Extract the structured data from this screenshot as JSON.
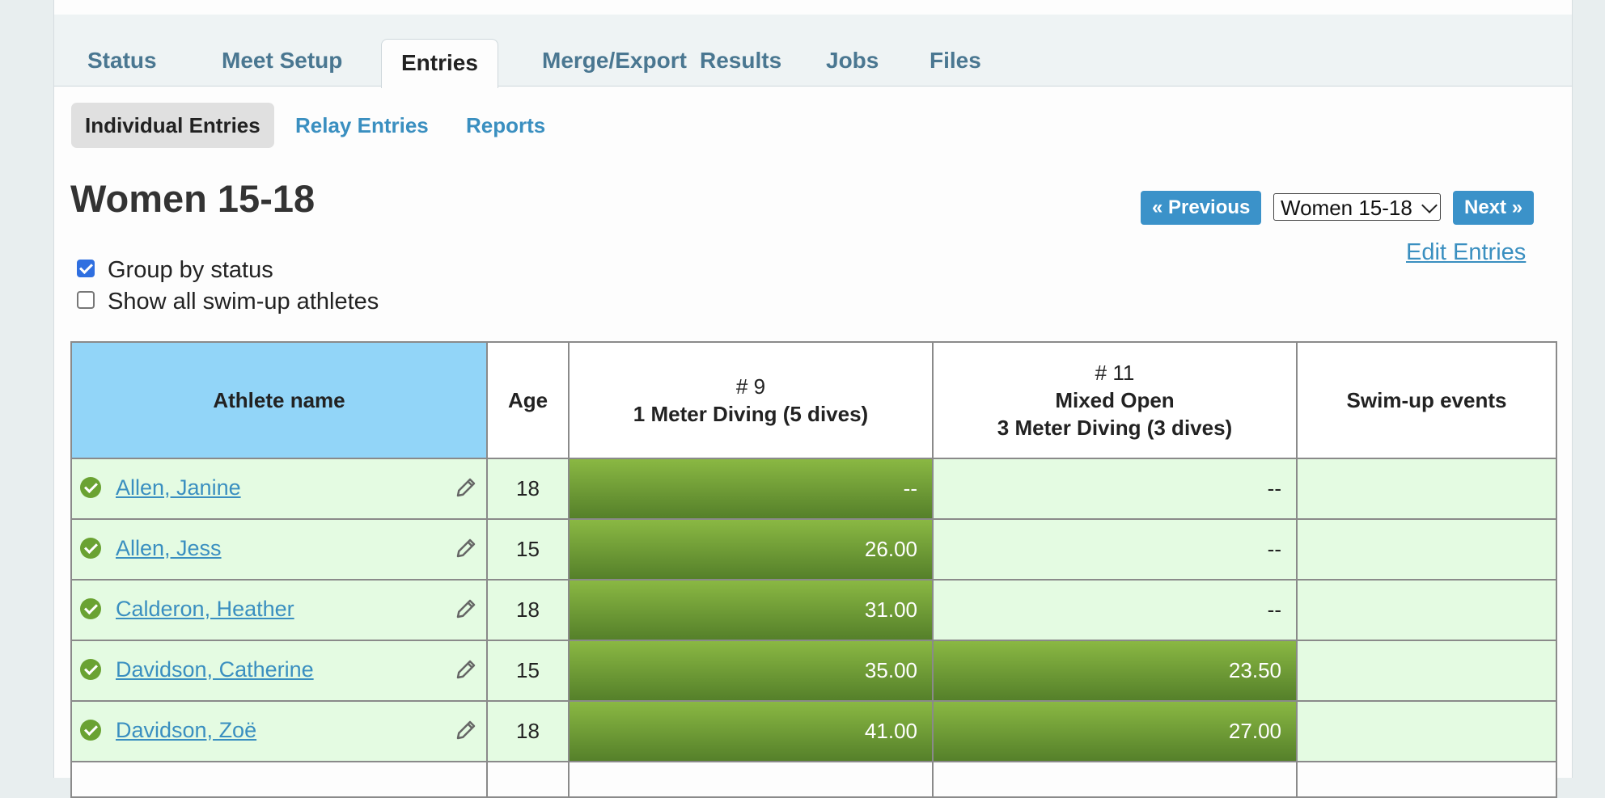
{
  "tabs": [
    {
      "label": "Status",
      "active": false
    },
    {
      "label": "Meet Setup",
      "active": false
    },
    {
      "label": "Entries",
      "active": true
    },
    {
      "label": "Merge/Export",
      "active": false
    },
    {
      "label": "Results",
      "active": false
    },
    {
      "label": "Jobs",
      "active": false
    },
    {
      "label": "Files",
      "active": false
    }
  ],
  "subtabs": [
    {
      "label": "Individual Entries",
      "active": true
    },
    {
      "label": "Relay Entries",
      "active": false
    },
    {
      "label": "Reports",
      "active": false
    }
  ],
  "page_title": "Women 15-18",
  "nav": {
    "previous_label": "« Previous",
    "next_label": "Next »",
    "group_select_value": "Women 15-18",
    "edit_entries_label": "Edit Entries"
  },
  "options": {
    "group_by_status": {
      "label": "Group by status",
      "checked": true
    },
    "show_all_swimup": {
      "label": "Show all swim-up athletes",
      "checked": false
    }
  },
  "table": {
    "headers": {
      "athlete_name": "Athlete name",
      "age": "Age",
      "event1_number": "# 9",
      "event1_name": "1 Meter Diving (5 dives)",
      "event2_number": "# 11",
      "event2_line1": "Mixed Open",
      "event2_line2": "3 Meter Diving (3 dives)",
      "swimup": "Swim-up events"
    },
    "rows": [
      {
        "name": "Allen, Janine",
        "age": "18",
        "event1": "--",
        "event2": "--",
        "swimup": ""
      },
      {
        "name": "Allen, Jess",
        "age": "15",
        "event1": "26.00",
        "event2": "--",
        "swimup": ""
      },
      {
        "name": "Calderon, Heather",
        "age": "18",
        "event1": "31.00",
        "event2": "--",
        "swimup": ""
      },
      {
        "name": "Davidson, Catherine",
        "age": "15",
        "event1": "35.00",
        "event2": "23.50",
        "swimup": ""
      },
      {
        "name": "Davidson, Zoë",
        "age": "18",
        "event1": "41.00",
        "event2": "27.00",
        "swimup": ""
      }
    ]
  },
  "colors": {
    "accent": "#3b92c9",
    "name_header": "#92d5f8",
    "row_bg": "#e4fbe2",
    "entered_green": "#6a9a34",
    "status_ok": "#6aa232"
  }
}
